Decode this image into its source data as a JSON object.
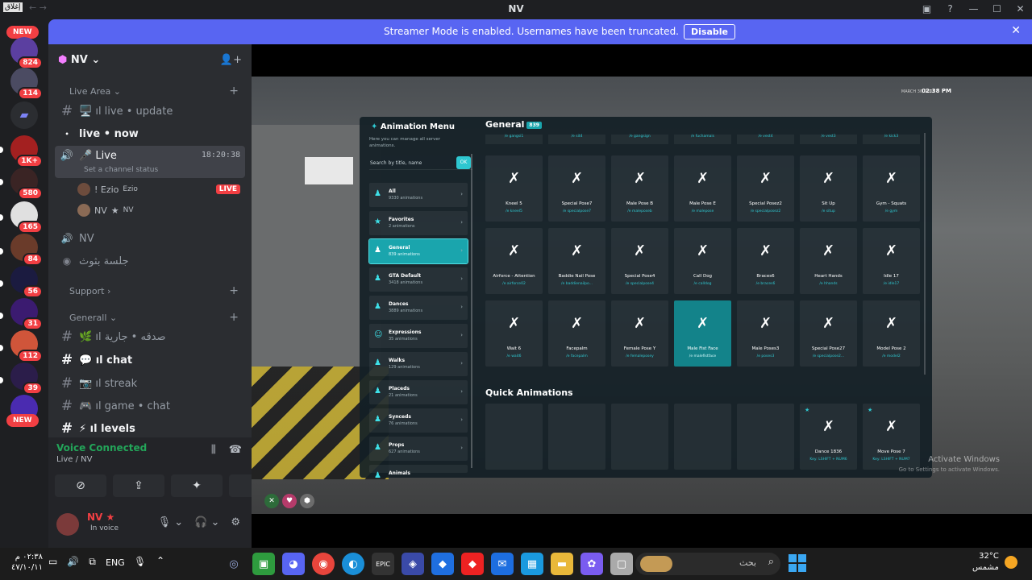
{
  "titlebar": {
    "title": "NV",
    "corner_label": "إغلاق"
  },
  "banner": {
    "text": "Streamer Mode is enabled. Usernames have been truncated.",
    "button": "Disable"
  },
  "rail": {
    "new_label": "NEW",
    "badges": [
      "824",
      "114",
      "1K+",
      "580",
      "165",
      "84",
      "56",
      "31",
      "112",
      "39"
    ]
  },
  "server": {
    "name": "NV",
    "categories": {
      "live_area": "Live Area",
      "support": "Support",
      "generall": "Generall"
    },
    "channels": {
      "live_update": "ıl live • update",
      "live_now": "live • now",
      "live_voice": "Live",
      "live_time": "18:20:38",
      "set_status": "Set a channel status",
      "user1": "! Ezio",
      "user1_tag": "Ezio",
      "live_badge": "LIVE",
      "user2": "NV",
      "user2_tag": "NV",
      "nv_voice": "NV",
      "arabic_voice": "جلسة بثوث",
      "sadaqa": "ıl صدقه • جارية",
      "chat": "ıl chat",
      "streak": "ıl streak",
      "game_chat": "ıl game • chat",
      "levels": "ıl levels"
    }
  },
  "voice": {
    "status": "Voice Connected",
    "channel": "Live / NV"
  },
  "user": {
    "name": "NV",
    "status": "In voice"
  },
  "stream": {
    "hud_date": "MARCH 30, 2026",
    "hud_time": "02:38 PM",
    "activate_title": "Activate Windows",
    "activate_sub": "Go to Settings to activate Windows."
  },
  "anim_menu": {
    "title": "Animation Menu",
    "description": "Here you can manage all server animations.",
    "search_placeholder": "Search by title, name",
    "search_button": "OK",
    "section_general": "General",
    "general_count": "839",
    "section_quick": "Quick Animations",
    "categories": [
      {
        "name": "All",
        "count": "9330 animations"
      },
      {
        "name": "Favorites",
        "count": "2 animations"
      },
      {
        "name": "General",
        "count": "839 animations"
      },
      {
        "name": "GTA Default",
        "count": "3418 animations"
      },
      {
        "name": "Dances",
        "count": "3889 animations"
      },
      {
        "name": "Expressions",
        "count": "35 animations"
      },
      {
        "name": "Walks",
        "count": "129 animations"
      },
      {
        "name": "Placeds",
        "count": "21 animations"
      },
      {
        "name": "Synceds",
        "count": "76 animations"
      },
      {
        "name": "Props",
        "count": "627 animations"
      },
      {
        "name": "Animals",
        "count": ""
      }
    ],
    "top_stubs": [
      "/e gangsi1",
      "/e sit4",
      "/e gangsign",
      "/e fuchamais",
      "/e vest4",
      "/e vest3",
      "/e kick3"
    ],
    "tiles": [
      {
        "name": "Kneel 5",
        "cmd": "/e kneel5"
      },
      {
        "name": "Special Pose7",
        "cmd": "/e specialpose7"
      },
      {
        "name": "Male Pose B",
        "cmd": "/e maleposeb"
      },
      {
        "name": "Male Pose E",
        "cmd": "/e malepose"
      },
      {
        "name": "Special Posez2",
        "cmd": "/e specialposez2"
      },
      {
        "name": "Sit Up",
        "cmd": "/e situp"
      },
      {
        "name": "Gym - Squats",
        "cmd": "/e gym"
      },
      {
        "name": "Airforce - Attention",
        "cmd": "/e airforce02"
      },
      {
        "name": "Baddie Nail Pose",
        "cmd": "/e baddienailpo..."
      },
      {
        "name": "Special Pose4",
        "cmd": "/e specialpose4"
      },
      {
        "name": "Call Dog",
        "cmd": "/e calldog"
      },
      {
        "name": "Braces6",
        "cmd": "/e braces6"
      },
      {
        "name": "Heart Hands",
        "cmd": "/e hhands"
      },
      {
        "name": "Idle 17",
        "cmd": "/e idle17"
      },
      {
        "name": "Wait 6",
        "cmd": "/e wait6"
      },
      {
        "name": "Facepalm",
        "cmd": "/e facepalm"
      },
      {
        "name": "Female Pose Y",
        "cmd": "/e femaleposey"
      },
      {
        "name": "Male Fist Face",
        "cmd": "/e malefistface"
      },
      {
        "name": "Male Poses3",
        "cmd": "/e poses3"
      },
      {
        "name": "Special Pose27",
        "cmd": "/e specialpose2..."
      },
      {
        "name": "Model Pose 2",
        "cmd": "/e model2"
      }
    ],
    "quick": [
      {
        "name": "",
        "key": ""
      },
      {
        "name": "",
        "key": ""
      },
      {
        "name": "",
        "key": ""
      },
      {
        "name": "",
        "key": ""
      },
      {
        "name": "",
        "key": ""
      },
      {
        "name": "Dance 1836",
        "key": "Key: LSHIFT + NUM6"
      },
      {
        "name": "Move Pose 7",
        "key": "Key: LSHIFT + NUM7"
      }
    ]
  },
  "taskbar": {
    "time": "٠٢:٣٨ م",
    "date": "٤٧/١٠/١١",
    "lang": "ENG",
    "search": "بحث",
    "temp": "32°C",
    "weather": "مشمس"
  }
}
